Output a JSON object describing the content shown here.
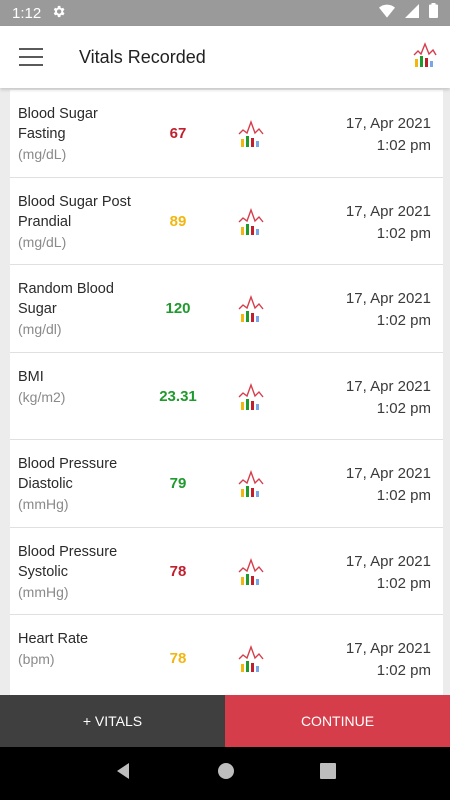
{
  "status_bar": {
    "time": "1:12",
    "icons": [
      "gear-icon",
      "wifi-icon",
      "signal-icon",
      "battery-icon"
    ]
  },
  "app_bar": {
    "title": "Vitals Recorded",
    "menu_icon": "hamburger-menu-icon",
    "chart_icon": "vitals-chart-icon"
  },
  "colors": {
    "red": "#c0202e",
    "yellow": "#f2b610",
    "green": "#1f9a2c",
    "continue_bg": "#d63d4a",
    "vitals_bg": "#3f3f3f"
  },
  "vitals": [
    {
      "name": "Blood Sugar Fasting",
      "unit": "(mg/dL)",
      "value": "67",
      "status": "red",
      "date": "17, Apr 2021",
      "time": "1:02 pm"
    },
    {
      "name": "Blood Sugar Post Prandial",
      "unit": "(mg/dL)",
      "value": "89",
      "status": "yellow",
      "date": "17, Apr 2021",
      "time": "1:02 pm"
    },
    {
      "name": "Random Blood Sugar",
      "unit": "(mg/dl)",
      "value": "120",
      "status": "green",
      "date": "17, Apr 2021",
      "time": "1:02 pm"
    },
    {
      "name": "BMI",
      "unit": "(kg/m2)",
      "value": "23.31",
      "status": "green",
      "date": "17, Apr 2021",
      "time": "1:02 pm"
    },
    {
      "name": "Blood Pressure Diastolic",
      "unit": "(mmHg)",
      "value": "79",
      "status": "green",
      "date": "17, Apr 2021",
      "time": "1:02 pm"
    },
    {
      "name": "Blood Pressure Systolic",
      "unit": "(mmHg)",
      "value": "78",
      "status": "red",
      "date": "17, Apr 2021",
      "time": "1:02 pm"
    },
    {
      "name": "Heart Rate",
      "unit": "(bpm)",
      "value": "78",
      "status": "yellow",
      "date": "17, Apr 2021",
      "time": "1:02 pm"
    }
  ],
  "buttons": {
    "add_vitals": "+ VITALS",
    "continue": "CONTINUE"
  },
  "nav_bar": {
    "back": "back-icon",
    "home": "home-icon",
    "recents": "recents-icon"
  }
}
